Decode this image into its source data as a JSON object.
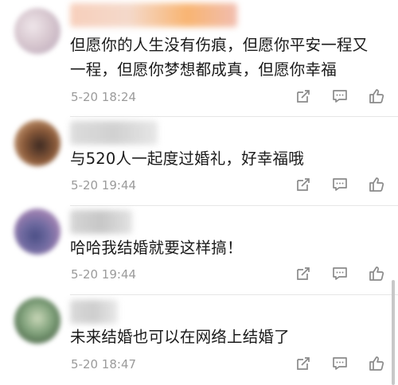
{
  "comments": [
    {
      "text": "但愿你的人生没有伤痕，但愿你平安一程又一程，但愿你梦想都成真，但愿你幸福",
      "time": "5-20 18:24",
      "avatar_colors": [
        "#d8c8d0",
        "#b9a6b8",
        "#efe6ea"
      ],
      "name_colors": [
        "#f6c7b0",
        "#f7a85a",
        "#efb2a2"
      ]
    },
    {
      "text": "与520人一起度过婚礼，好幸福哦",
      "time": "5-20 19:44",
      "avatar_colors": [
        "#8a5a3a",
        "#3d2a22",
        "#c79a74"
      ],
      "name_colors": [
        "#d7d7d7",
        "#c9c9c9",
        "#e3e3e3"
      ]
    },
    {
      "text": "哈哈我结婚就要这样搞！",
      "time": "5-20 19:44",
      "avatar_colors": [
        "#4b4f86",
        "#9b7fb0",
        "#c9c6dc"
      ],
      "name_colors": [
        "#cfcfcf",
        "#bdbdbd",
        "#dedede"
      ]
    },
    {
      "text": "未来结婚也可以在网络上结婚了",
      "time": "5-20 18:47",
      "avatar_colors": [
        "#7fa07a",
        "#c9d7b8",
        "#4f6a4c"
      ],
      "name_colors": [
        "#d3d3d3",
        "#c5c5c5",
        "#e5e5e5"
      ]
    }
  ],
  "icons": {
    "share": "share-icon",
    "reply": "comment-icon",
    "like": "thumbs-up-icon"
  },
  "colors": {
    "icon": "#8a8a8a",
    "time": "#9b9b9b",
    "text": "#1a1a1a"
  }
}
